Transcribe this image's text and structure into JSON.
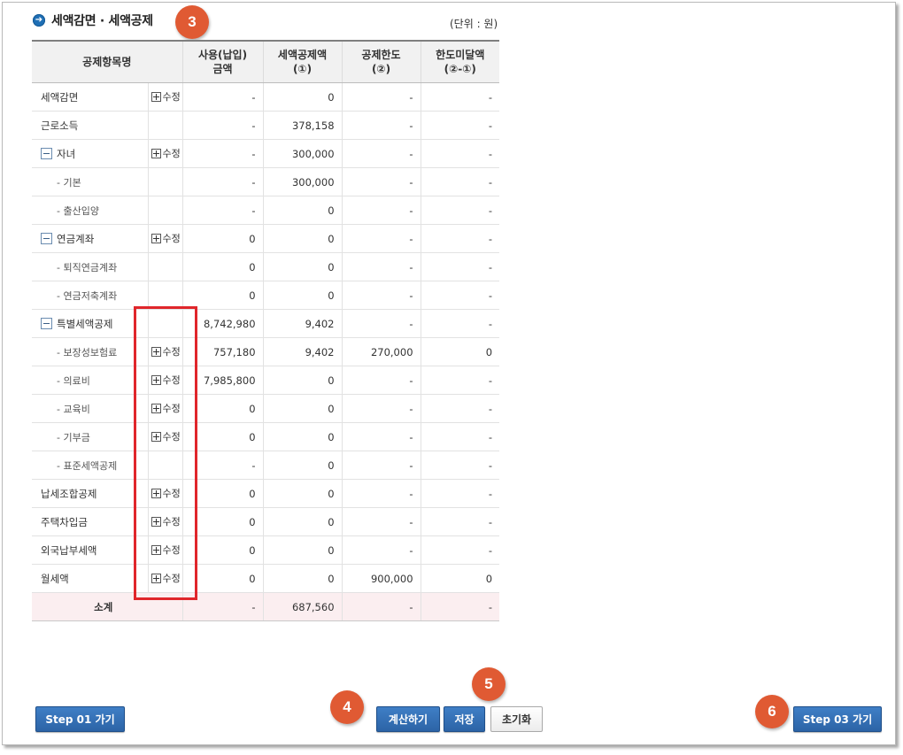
{
  "header": {
    "title": "세액감면 · 세액공제",
    "unit": "(단위 : 원)"
  },
  "badges": [
    "3",
    "4",
    "5",
    "6"
  ],
  "table": {
    "headers": {
      "item": "공제항목명",
      "usage_line1": "사용(납입)",
      "usage_line2": "금액",
      "credit_line1": "세액공제액",
      "credit_line2": "(①)",
      "limit_line1": "공제한도",
      "limit_line2": "(②)",
      "short_line1": "한도미달액",
      "short_line2": "(②-①)"
    },
    "edit_label": "수정",
    "rows": [
      {
        "name": "세액감면",
        "usage": "-",
        "credit": "0",
        "limit": "-",
        "short": "-"
      },
      {
        "name": "근로소득",
        "usage": "-",
        "credit": "378,158",
        "limit": "-",
        "short": "-"
      },
      {
        "name": "자녀",
        "usage": "-",
        "credit": "300,000",
        "limit": "-",
        "short": "-"
      },
      {
        "name": "- 기본",
        "usage": "-",
        "credit": "300,000",
        "limit": "-",
        "short": "-"
      },
      {
        "name": "- 출산입양",
        "usage": "-",
        "credit": "0",
        "limit": "-",
        "short": "-"
      },
      {
        "name": "연금계좌",
        "usage": "0",
        "credit": "0",
        "limit": "-",
        "short": "-"
      },
      {
        "name": "- 퇴직연금계좌",
        "usage": "0",
        "credit": "0",
        "limit": "-",
        "short": "-"
      },
      {
        "name": "- 연금저축계좌",
        "usage": "0",
        "credit": "0",
        "limit": "-",
        "short": "-"
      },
      {
        "name": "특별세액공제",
        "usage": "8,742,980",
        "credit": "9,402",
        "limit": "-",
        "short": "-"
      },
      {
        "name": "- 보장성보험료",
        "usage": "757,180",
        "credit": "9,402",
        "limit": "270,000",
        "short": "0"
      },
      {
        "name": "- 의료비",
        "usage": "7,985,800",
        "credit": "0",
        "limit": "-",
        "short": "-"
      },
      {
        "name": "- 교육비",
        "usage": "0",
        "credit": "0",
        "limit": "-",
        "short": "-"
      },
      {
        "name": "- 기부금",
        "usage": "0",
        "credit": "0",
        "limit": "-",
        "short": "-"
      },
      {
        "name": "- 표준세액공제",
        "usage": "-",
        "credit": "0",
        "limit": "-",
        "short": "-"
      },
      {
        "name": "납세조합공제",
        "usage": "0",
        "credit": "0",
        "limit": "-",
        "short": "-"
      },
      {
        "name": "주택차입금",
        "usage": "0",
        "credit": "0",
        "limit": "-",
        "short": "-"
      },
      {
        "name": "외국납부세액",
        "usage": "0",
        "credit": "0",
        "limit": "-",
        "short": "-"
      },
      {
        "name": "월세액",
        "usage": "0",
        "credit": "0",
        "limit": "900,000",
        "short": "0"
      }
    ],
    "total": {
      "name": "소계",
      "usage": "-",
      "credit": "687,560",
      "limit": "-",
      "short": "-"
    }
  },
  "buttons": {
    "step01": "Step 01 가기",
    "calculate": "계산하기",
    "save": "저장",
    "reset": "초기화",
    "step03": "Step 03 가기"
  },
  "colors": {
    "accent_blue": "#2c64a6",
    "badge_orange": "#e05a33",
    "highlight_red": "#e0262b",
    "total_row": "#fbeef0"
  }
}
